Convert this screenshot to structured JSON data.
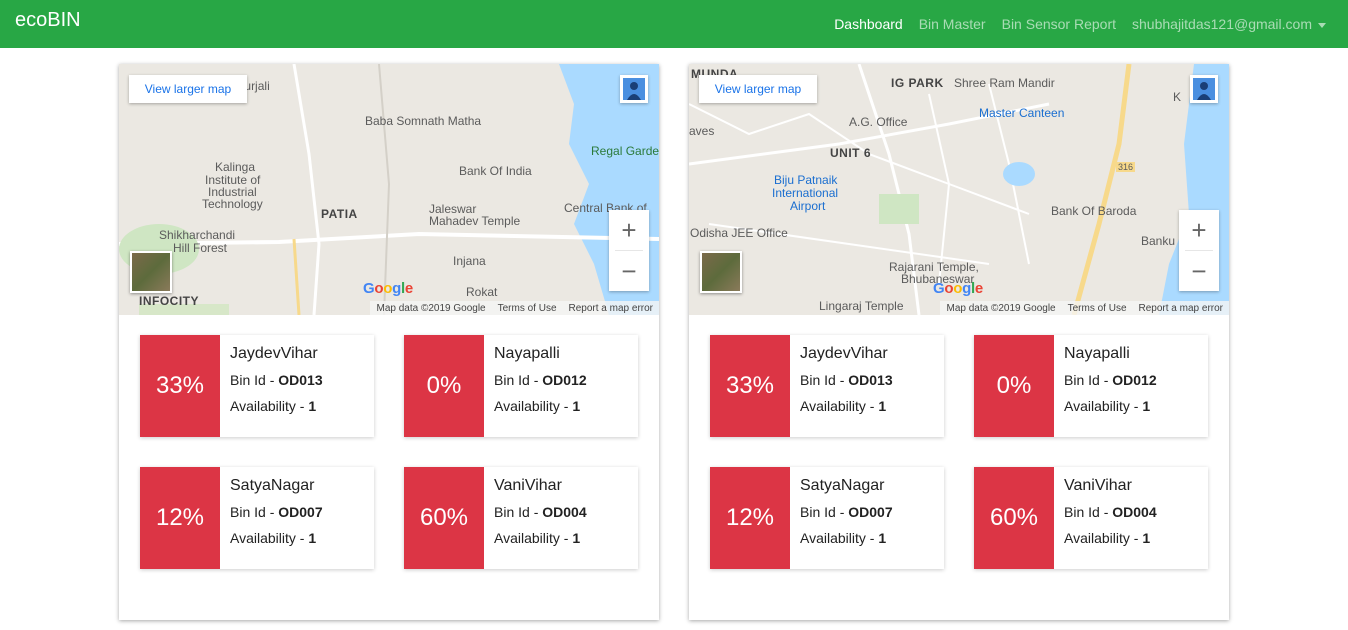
{
  "navbar": {
    "brand": "ecoBIN",
    "links": [
      {
        "label": "Dashboard",
        "active": true
      },
      {
        "label": "Bin Master",
        "active": false
      },
      {
        "label": "Bin Sensor Report",
        "active": false
      },
      {
        "label": "shubhajitdas121@gmail.com",
        "active": false
      }
    ]
  },
  "map_common": {
    "larger_map": "View larger map",
    "attribution": "Map data ©2019 Google",
    "terms": "Terms of Use",
    "report": "Report a map error",
    "google": "Google",
    "zoom_in": "+",
    "zoom_out": "−"
  },
  "map1": {
    "labels": [
      "Raghunathpurjali",
      "Baba Somnath Matha",
      "Kalinga",
      "Institute of",
      "Industrial",
      "Technology",
      "PATIA",
      "Jaleswar",
      "Mahadev Temple",
      "Bank Of India",
      "Regal Garde",
      "Central Bank of",
      "Shikharchandi",
      "Hill Forest",
      "Injana",
      "Rokat",
      "INFOCITY"
    ]
  },
  "map2": {
    "labels": [
      "MUNDA",
      "IG PARK",
      "Shree Ram Mandir",
      "A.G. Office",
      "Master Canteen",
      "UNIT 6",
      "Biju Patnaik",
      "International",
      "Airport",
      "aves",
      "Odisha JEE Office",
      "Bank Of Baroda",
      "Banku",
      "Rajarani Temple,",
      "Bhubaneswar",
      "Lingaraj Temple",
      "316",
      "K"
    ]
  },
  "bins": [
    {
      "percent": "33%",
      "name": "JaydevVihar",
      "bin_label": "Bin Id - ",
      "bin_id": "OD013",
      "avail_label": "Availability - ",
      "availability": "1"
    },
    {
      "percent": "0%",
      "name": "Nayapalli",
      "bin_label": "Bin Id - ",
      "bin_id": "OD012",
      "avail_label": "Availability - ",
      "availability": "1"
    },
    {
      "percent": "12%",
      "name": "SatyaNagar",
      "bin_label": "Bin Id - ",
      "bin_id": "OD007",
      "avail_label": "Availability - ",
      "availability": "1"
    },
    {
      "percent": "60%",
      "name": "VaniVihar",
      "bin_label": "Bin Id - ",
      "bin_id": "OD004",
      "avail_label": "Availability - ",
      "availability": "1"
    }
  ],
  "colors": {
    "navbar": "#28a745",
    "percent_bg": "#dc3545"
  }
}
